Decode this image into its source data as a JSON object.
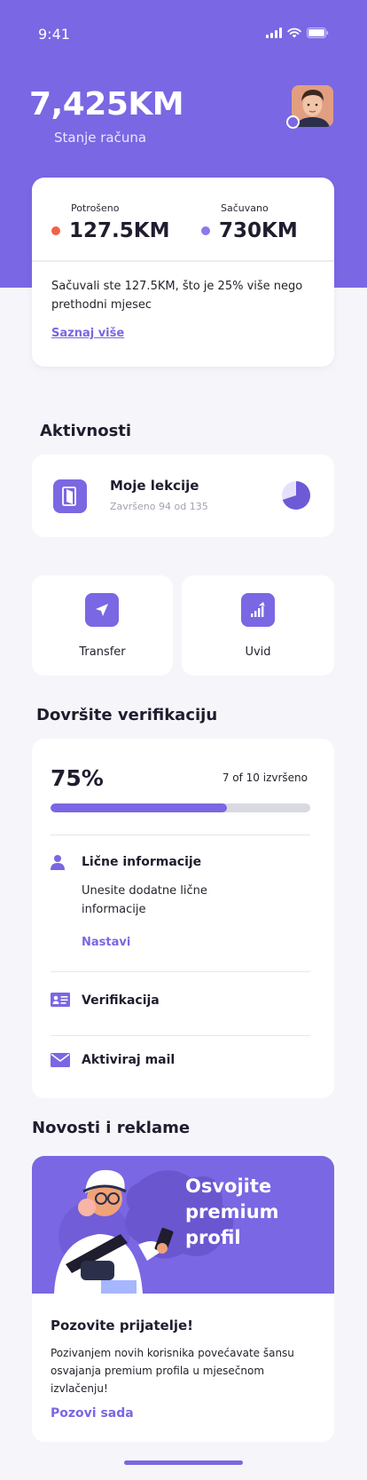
{
  "status_bar": {
    "time": "9:41"
  },
  "account": {
    "balance": "7,425KM",
    "balance_label": "Stanje računa"
  },
  "summary": {
    "spent_label": "Potrošeno",
    "spent_value": "127.5KM",
    "saved_label": "Sačuvano",
    "saved_value": "730KM",
    "text": "Sačuvali ste 127.5KM, što je 25% više nego prethodni mjesec",
    "link": "Saznaj više",
    "colors": {
      "spent": "#f2614a",
      "saved": "#8b79ec"
    }
  },
  "activities": {
    "title": "Aktivnosti",
    "lesson_title": "Moje lekcije",
    "lesson_subtitle": "Završeno 94 od 135",
    "lesson_progress": 0.7
  },
  "quick_actions": [
    {
      "label": "Transfer",
      "icon": "send-icon"
    },
    {
      "label": "Uvid",
      "icon": "chart-up-icon"
    }
  ],
  "verification": {
    "title": "Dovršite verifikaciju",
    "percent": "75%",
    "count": "7 of 10 izvršeno",
    "progress": 0.68,
    "items": [
      {
        "title": "Lične informacije",
        "description": "Unesite dodatne lične informacije",
        "link": "Nastavi",
        "icon": "user-icon"
      },
      {
        "title": "Verifikacija",
        "icon": "id-card-icon"
      },
      {
        "title": "Aktiviraj mail",
        "icon": "mail-icon"
      }
    ]
  },
  "news": {
    "title": "Novosti i reklame",
    "banner_heading": "Osvojite premium profil",
    "card_title": "Pozovite prijatelje!",
    "card_text": "Pozivanjem novih korisnika povećavate šansu osvajanja premium profila u mjesečnom izvlačenju!",
    "link": "Pozovi sada"
  },
  "colors": {
    "primary": "#7a67e3",
    "background": "#f6f6fa"
  }
}
